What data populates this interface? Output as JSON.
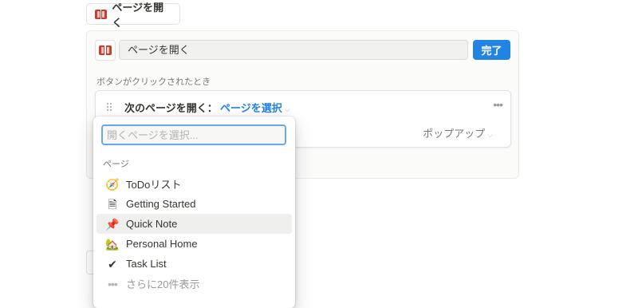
{
  "top_button": {
    "label": "ページを開く",
    "icon": "book-icon"
  },
  "editor": {
    "name_value": "ページを開く",
    "done_label": "完了",
    "section_label": "ボタンがクリックされたとき",
    "action": {
      "label": "次のページを開く：",
      "page_select": "ページを選択",
      "more": "•••",
      "open_mode": "ポップアップ"
    }
  },
  "dropdown": {
    "search_placeholder": "開くページを選択...",
    "group_label": "ページ",
    "items": [
      {
        "label": "ToDoリスト",
        "icon": "compass-icon",
        "glyph": "🧭"
      },
      {
        "label": "Getting Started",
        "icon": "page-icon",
        "glyph": "🗎"
      },
      {
        "label": "Quick Note",
        "icon": "pushpin-icon",
        "glyph": "📌"
      },
      {
        "label": "Personal Home",
        "icon": "house-icon",
        "glyph": "🏡"
      },
      {
        "label": "Task List",
        "icon": "checkmark-icon",
        "glyph": "✔"
      }
    ],
    "more_label": "さらに20件表示",
    "more_glyph": "•••"
  },
  "colors": {
    "accent": "#2383e2",
    "text": "#37352f",
    "muted": "#787774"
  }
}
